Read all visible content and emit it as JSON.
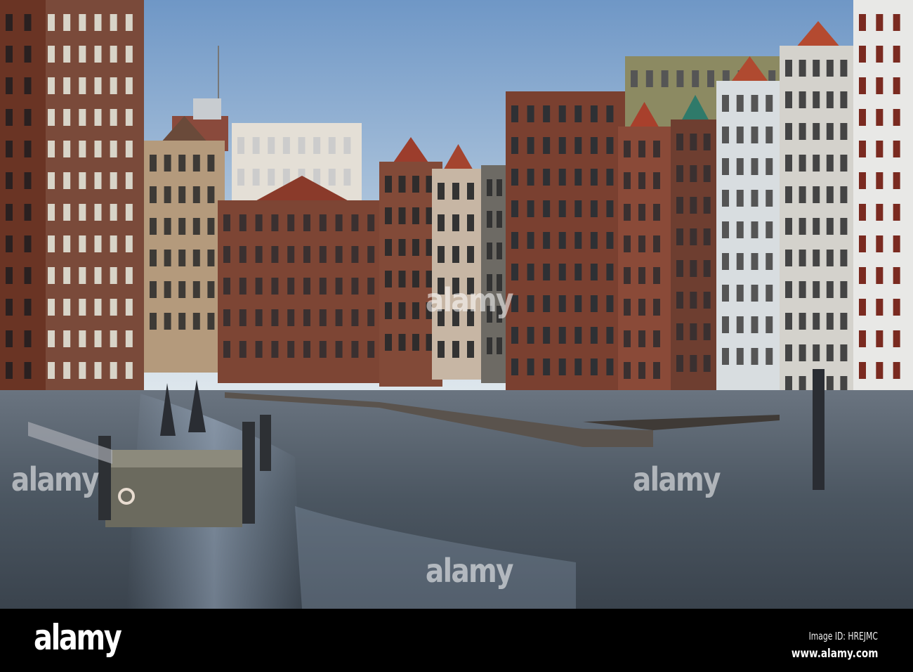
{
  "watermark": {
    "text": "alamy"
  },
  "footer": {
    "logo": "alamy",
    "image_id": "Image ID: HREJMC",
    "website": "www.alamy.com"
  },
  "colors": {
    "sky_top": "#6f97c6",
    "sky_bottom": "#dfe8ee",
    "brick": "#7a3f2e",
    "water": "#4b5661",
    "footer": "#000000"
  }
}
